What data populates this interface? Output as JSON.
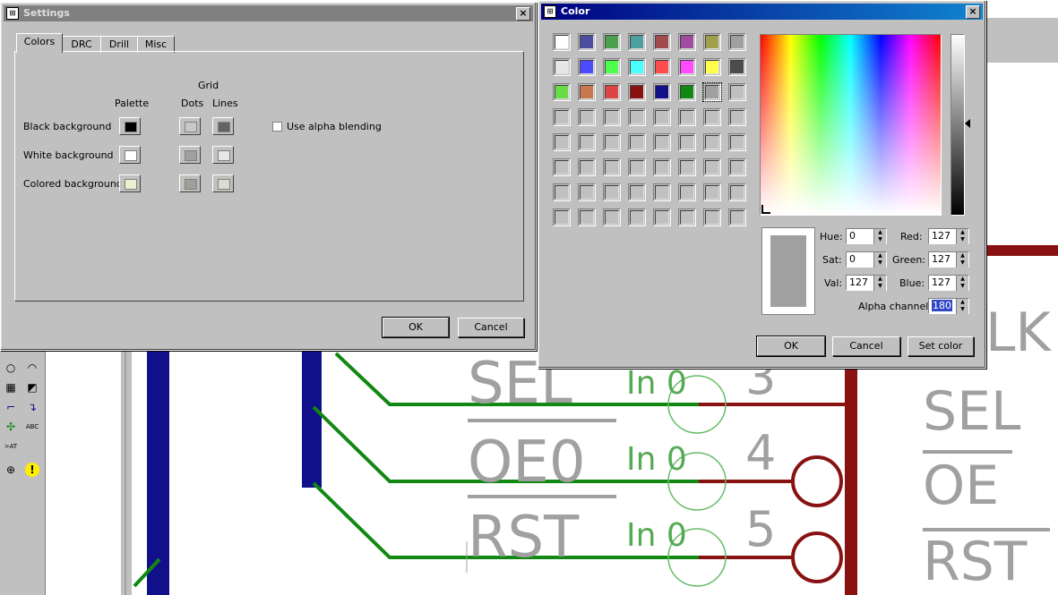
{
  "settings": {
    "title": "Settings",
    "tabs": [
      {
        "label": "Colors"
      },
      {
        "label": "DRC"
      },
      {
        "label": "Drill"
      },
      {
        "label": "Misc"
      }
    ],
    "grid_heading": "Grid",
    "col_palette": "Palette",
    "col_dots": "Dots",
    "col_lines": "Lines",
    "rows": [
      {
        "label": "Black background",
        "palette": "#000000",
        "dots": "#c8c8c8",
        "lines": "#646464"
      },
      {
        "label": "White background",
        "palette": "#ffffff",
        "dots": "#a0a0a0",
        "lines": "#e6e6e6"
      },
      {
        "label": "Colored background",
        "palette": "#eeeed0",
        "dots": "#a0a098",
        "lines": "#dcdcd0"
      }
    ],
    "alpha_label": "Use alpha blending",
    "ok": "OK",
    "cancel": "Cancel"
  },
  "color": {
    "title": "Color",
    "palette": [
      "#ffffff",
      "#4c4ca0",
      "#4ca04c",
      "#4ca0a0",
      "#a04c4c",
      "#a04ca0",
      "#a0a04c",
      "#a0a0a0",
      "#e6e6e6",
      "#4c4cff",
      "#4cff4c",
      "#4cffff",
      "#ff4c4c",
      "#ff4cff",
      "#ffff4c",
      "#4c4c4c",
      "#66dd44",
      "#c8784c",
      "#dd4444",
      "#881111",
      "#111188",
      "#118811",
      "#a0a0a0",
      "#c0c0c0"
    ],
    "preview": "#a0a0a0",
    "hue_label": "Hue:",
    "hue": "0",
    "sat_label": "Sat:",
    "sat": "0",
    "val_label": "Val:",
    "val": "127",
    "red_label": "Red:",
    "red": "127",
    "green_label": "Green:",
    "green": "127",
    "blue_label": "Blue:",
    "blue": "127",
    "alpha_label": "Alpha channel:",
    "alpha": "180",
    "ok": "OK",
    "cancel": "Cancel",
    "set_color": "Set color"
  },
  "schematic": {
    "labels": [
      "SEL",
      "OE0",
      "RST",
      "SEL",
      "OE",
      "RST"
    ],
    "pin_text": "In 0",
    "pin_numbers": [
      "3",
      "4",
      "5"
    ],
    "partial_label": "LK"
  }
}
